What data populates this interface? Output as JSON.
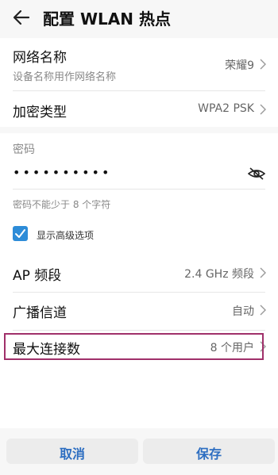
{
  "header": {
    "title": "配置 WLAN 热点"
  },
  "settings": {
    "network_name": {
      "label": "网络名称",
      "sublabel": "设备名称用作网络名称",
      "value": "荣耀9"
    },
    "encryption": {
      "label": "加密类型",
      "value": "WPA2 PSK"
    },
    "password": {
      "label": "密码",
      "masked_value": "••••••••••",
      "hint": "密码不能少于 8 个字符"
    },
    "advanced": {
      "label": "显示高级选项",
      "checked": true
    },
    "ap_band": {
      "label": "AP 频段",
      "value": "2.4 GHz 频段"
    },
    "channel": {
      "label": "广播信道",
      "value": "自动"
    },
    "max_connections": {
      "label": "最大连接数",
      "value": "8 个用户"
    }
  },
  "footer": {
    "cancel_label": "取消",
    "save_label": "保存"
  },
  "colors": {
    "accent": "#2d8cd8",
    "button_text": "#2d6ec1",
    "highlight": "#a0306a"
  }
}
